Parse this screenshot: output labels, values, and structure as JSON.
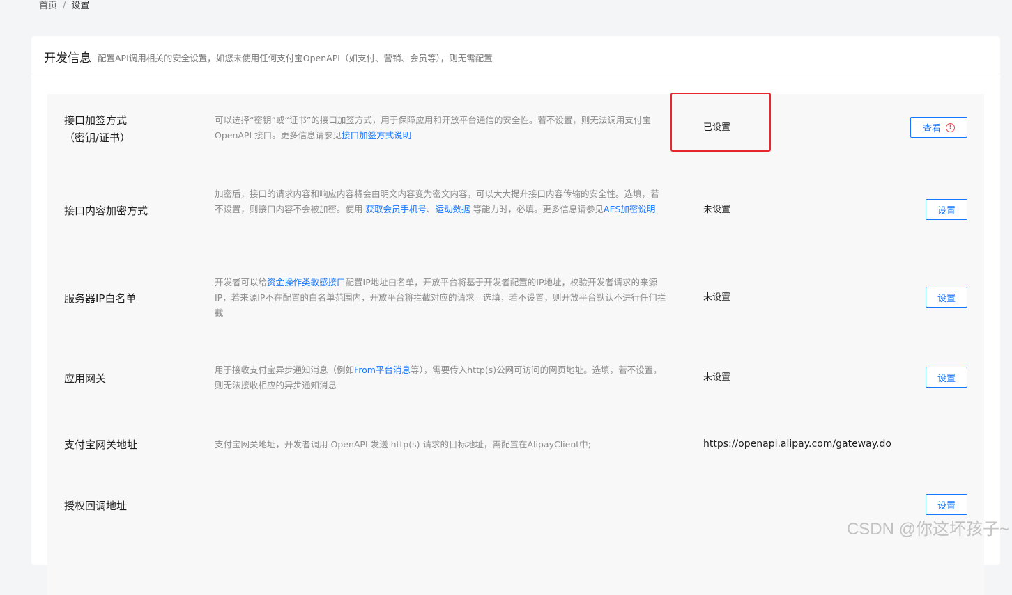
{
  "breadcrumb": {
    "home": "首页",
    "separator": "/",
    "current": "设置"
  },
  "section": {
    "title": "开发信息",
    "description": "配置API调用相关的安全设置，如您未使用任何支付宝OpenAPI（如支付、营销、会员等），则无需配置"
  },
  "rows": [
    {
      "title_line1": "接口加签方式",
      "title_line2": "（密钥/证书）",
      "desc_text": "可以选择“密钥”或“证书”的接口加签方式，用于保障应用和开放平台通信的安全性。若不设置，则无法调用支付宝 OpenAPI 接口。更多信息请参见",
      "desc_link": "接口加签方式说明",
      "status": "已设置",
      "button": "查看",
      "button_icon": "warning-circle-icon"
    },
    {
      "title": "接口内容加密方式",
      "desc_part1": "加密后，接口的请求内容和响应内容将会由明文内容变为密文内容，可以大大提升接口内容传输的安全性。选填，若不设置，则接口内容不会被加密。使用 ",
      "desc_link1": "获取会员手机号",
      "desc_sep": "、",
      "desc_link2": "运动数据",
      "desc_part2": " 等能力时，必填。更多信息请参见",
      "desc_link3": "AES加密说明",
      "status": "未设置",
      "button": "设置"
    },
    {
      "title": "服务器IP白名单",
      "desc_part1": "开发者可以给",
      "desc_link": "资金操作类敏感接口",
      "desc_part2": "配置IP地址白名单，开放平台将基于开发者配置的IP地址，校验开发者请求的来源IP，若来源IP不在配置的白名单范围内，开放平台将拦截对应的请求。选填，若不设置，则开放平台默认不进行任何拦截",
      "status": "未设置",
      "button": "设置"
    },
    {
      "title": "应用网关",
      "desc_part1": "用于接收支付宝异步通知消息（例如",
      "desc_link": "From平台消息",
      "desc_part2": "等），需要传入http(s)公网可访问的网页地址。选填，若不设置，则无法接收相应的异步通知消息",
      "status": "未设置",
      "button": "设置"
    },
    {
      "title": "支付宝网关地址",
      "desc": "支付宝网关地址，开发者调用 OpenAPI 发送 http(s) 请求的目标地址，需配置在AlipayClient中;",
      "value": "https://openapi.alipay.com/gateway.do"
    },
    {
      "title": "授权回调地址",
      "button": "设置"
    }
  ],
  "watermark": "CSDN @你这坏孩子~",
  "colors": {
    "link": "#1677ff",
    "highlight": "#e8262d",
    "warning": "#e5484d"
  }
}
